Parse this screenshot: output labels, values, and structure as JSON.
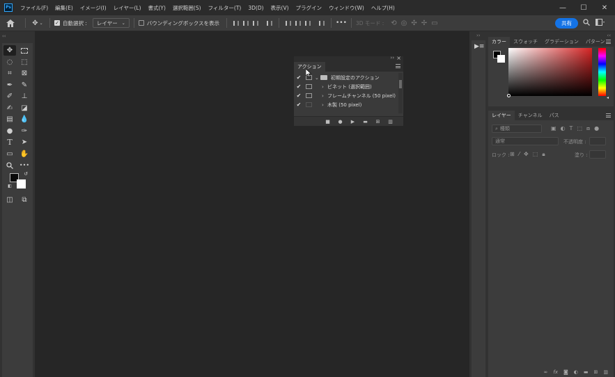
{
  "app": {
    "logo_text": "Ps",
    "menu": [
      "ファイル(F)",
      "編集(E)",
      "イメージ(I)",
      "レイヤー(L)",
      "書式(Y)",
      "選択範囲(S)",
      "フィルター(T)",
      "3D(D)",
      "表示(V)",
      "プラグイン",
      "ウィンドウ(W)",
      "ヘルプ(H)"
    ],
    "window_controls": [
      "—",
      "☐",
      "✕"
    ]
  },
  "options_bar": {
    "auto_select_label": "自動選択 :",
    "auto_select_checked": true,
    "layer_dropdown": "レイヤー",
    "bounding_box_label": "バウンディングボックスを表示",
    "bounding_box_checked": false,
    "more": "•••",
    "mode_3d": "3D モード :",
    "share_button": "共有"
  },
  "toolbar": {
    "tools": [
      "move-tool",
      "marquee-tool",
      "lasso-tool",
      "object-select-tool",
      "crop-tool",
      "frame-tool",
      "eyedropper-tool",
      "healing-brush-tool",
      "brush-tool",
      "clone-stamp-tool",
      "history-brush-tool",
      "eraser-tool",
      "gradient-tool",
      "blur-tool",
      "dodge-tool",
      "pen-tool",
      "type-tool",
      "path-select-tool",
      "rectangle-tool",
      "hand-tool",
      "zoom-tool",
      "more-tools"
    ],
    "foreground_color": "#0a0a0a",
    "background_color": "#ffffff"
  },
  "actions_panel": {
    "tab": "アクション",
    "rows": [
      {
        "checked": true,
        "dialog": true,
        "expand": "⌄",
        "folder": true,
        "label": "初期設定のアクション"
      },
      {
        "checked": true,
        "dialog": true,
        "expand": "›",
        "folder": false,
        "label": "ビネット (選択範囲)"
      },
      {
        "checked": true,
        "dialog": true,
        "expand": "›",
        "folder": false,
        "label": "フレームチャンネル (50 pixel)"
      },
      {
        "checked": true,
        "dialog": false,
        "expand": "›",
        "folder": false,
        "label": "木製 (50 pixel)"
      }
    ],
    "footer_icons": [
      "stop-icon",
      "record-icon",
      "play-icon",
      "folder-icon",
      "new-action-icon",
      "trash-icon"
    ]
  },
  "color_panel": {
    "tabs": [
      "カラー",
      "スウォッチ",
      "グラデーション",
      "パターン"
    ],
    "active_tab": "カラー",
    "foreground": "#000000",
    "background": "#ffffff",
    "hue_color": "#d62424"
  },
  "layers_panel": {
    "tabs": [
      "レイヤー",
      "チャンネル",
      "パス"
    ],
    "active_tab": "レイヤー",
    "search_placeholder": "種類",
    "blend_mode": "通常",
    "opacity_label": "不透明度 :",
    "lock_label": "ロック :",
    "fill_label": "塗り :",
    "footer_icons": [
      "link-icon",
      "fx-icon",
      "mask-icon",
      "adjustment-icon",
      "group-icon",
      "new-layer-icon",
      "trash-icon"
    ]
  }
}
